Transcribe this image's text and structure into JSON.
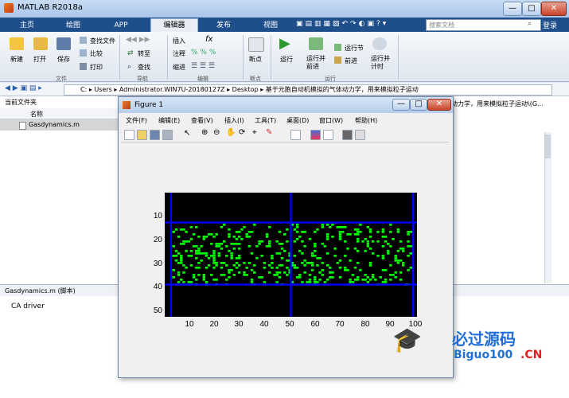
{
  "window": {
    "title": "MATLAB R2018a",
    "min": "—",
    "max": "□",
    "close": "✕"
  },
  "tabs": [
    {
      "label": "主页"
    },
    {
      "label": "绘图"
    },
    {
      "label": "APP"
    },
    {
      "label": "编辑器"
    },
    {
      "label": "发布"
    },
    {
      "label": "视图"
    }
  ],
  "search": {
    "placeholder": "搜索文档"
  },
  "login": "登录",
  "ribbon": {
    "file": {
      "new": "新建",
      "open": "打开",
      "save": "保存",
      "find_files": "查找文件",
      "compare": "比较",
      "print": "打印",
      "group": "文件"
    },
    "nav": {
      "goto": "转至",
      "find": "查找",
      "group": "导航"
    },
    "edit": {
      "insert": "插入",
      "comment": "注释",
      "indent": "缩进",
      "group": "编辑",
      "fx": "fx"
    },
    "breakpoints": {
      "label": "断点",
      "group": "断点"
    },
    "run": {
      "run": "运行",
      "run_advance": "运行并\n前进",
      "run_section": "运行节",
      "advance": "前进",
      "run_time": "运行并\n计时",
      "group": "运行"
    }
  },
  "address": {
    "path": [
      "C:",
      "Users",
      "Administrator.WIN7U-20180127Z",
      "Desktop",
      "基于元胞自动机模拟的气体动力学，用来模拟粒子运动"
    ],
    "right_overflow": "动力学，用来模拟粒子运动\\(G..."
  },
  "left_panel": {
    "title": "当前文件夹",
    "col_name": "名称",
    "file": "Gasdynamics.m"
  },
  "detail": {
    "header": "Gasdynamics.m  (脚本)",
    "text": "CA driver"
  },
  "figure": {
    "title": "Figure 1",
    "menu": [
      "文件(F)",
      "编辑(E)",
      "查看(V)",
      "插入(I)",
      "工具(T)",
      "桌面(D)",
      "窗口(W)",
      "帮助(H)"
    ]
  },
  "chart_data": {
    "type": "heatmap",
    "description_axes": "image of lattice gas cells",
    "y_ticks": [
      "10",
      "20",
      "30",
      "40",
      "50"
    ],
    "x_ticks": [
      "10",
      "20",
      "30",
      "40",
      "50",
      "60",
      "70",
      "80",
      "90",
      "100"
    ],
    "xlim": [
      0,
      100
    ],
    "ylim": [
      0,
      52
    ],
    "background": "#000000",
    "particle_color": "#00ff00",
    "wall_color": "#0000ff",
    "walls_h_y": [
      12.5,
      38.5
    ],
    "walls_v_x": [
      2.5,
      50,
      98.5
    ],
    "particle_band_y": [
      13,
      38
    ]
  },
  "watermark": {
    "cn": "必过源码",
    "en": "Biguo100",
    "suffix": ".CN"
  }
}
